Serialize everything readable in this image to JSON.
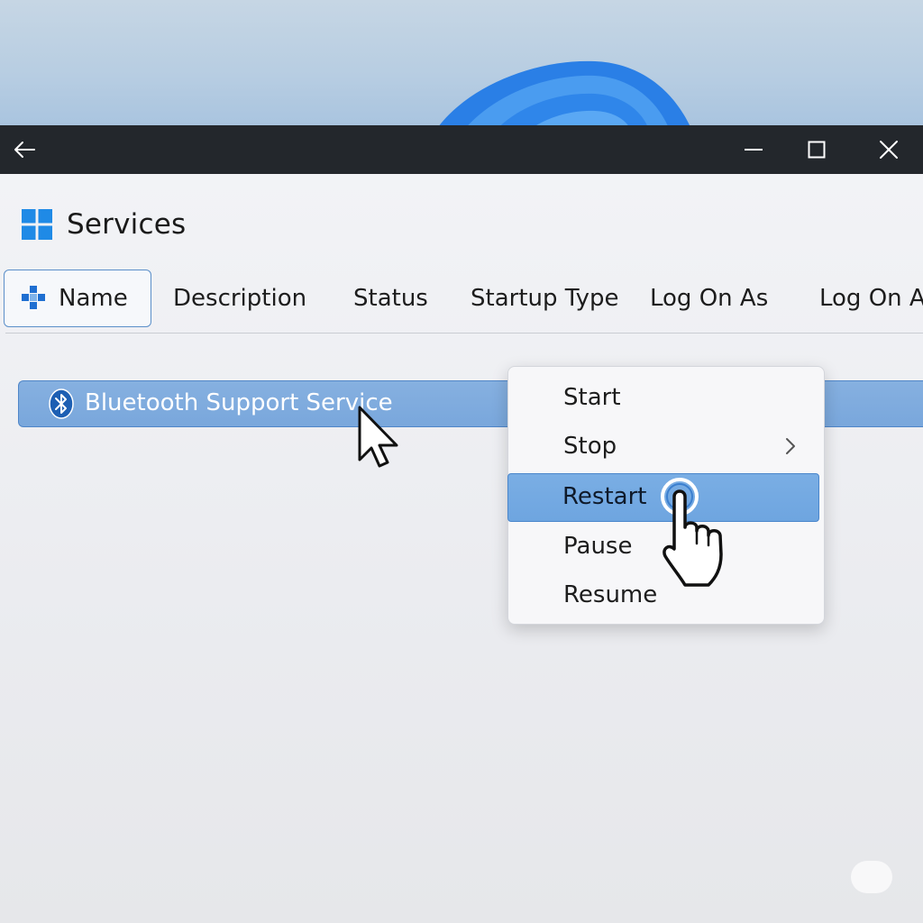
{
  "window": {
    "title": "Services"
  },
  "titlebar": {
    "back_icon": "back-arrow-icon",
    "minimize_icon": "minimize-icon",
    "maximize_icon": "maximize-icon",
    "close_icon": "close-icon"
  },
  "columns": [
    {
      "label": "Name",
      "active": true
    },
    {
      "label": "Description"
    },
    {
      "label": "Status"
    },
    {
      "label": "Startup Type"
    },
    {
      "label": "Log On As"
    },
    {
      "label": "Log On A"
    }
  ],
  "services": [
    {
      "name": "Bluetooth Support Service",
      "icon": "bluetooth-icon",
      "selected": true
    }
  ],
  "context_menu": {
    "items": [
      {
        "label": "Start"
      },
      {
        "label": "Stop",
        "has_submenu": true
      },
      {
        "label": "Restart",
        "highlighted": true
      },
      {
        "label": "Pause"
      },
      {
        "label": "Resume"
      }
    ]
  },
  "colors": {
    "accent": "#0078d4",
    "selection": "#7aaee4",
    "titlebar": "#23272c"
  }
}
